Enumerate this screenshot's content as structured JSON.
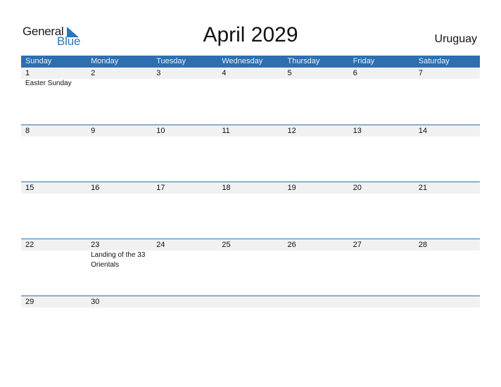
{
  "logo": {
    "word1": "General",
    "word2": "Blue",
    "icon": "triangle-flag-icon"
  },
  "title": "April 2029",
  "country": "Uruguay",
  "colors": {
    "header_bg": "#2e6fb0",
    "logo_blue": "#2a75bb",
    "row_strip": "#f1f1f1"
  },
  "weekdays": [
    "Sunday",
    "Monday",
    "Tuesday",
    "Wednesday",
    "Thursday",
    "Friday",
    "Saturday"
  ],
  "weeks": [
    {
      "days": [
        "1",
        "2",
        "3",
        "4",
        "5",
        "6",
        "7"
      ],
      "events": [
        "Easter Sunday",
        "",
        "",
        "",
        "",
        "",
        ""
      ]
    },
    {
      "days": [
        "8",
        "9",
        "10",
        "11",
        "12",
        "13",
        "14"
      ],
      "events": [
        "",
        "",
        "",
        "",
        "",
        "",
        ""
      ]
    },
    {
      "days": [
        "15",
        "16",
        "17",
        "18",
        "19",
        "20",
        "21"
      ],
      "events": [
        "",
        "",
        "",
        "",
        "",
        "",
        ""
      ]
    },
    {
      "days": [
        "22",
        "23",
        "24",
        "25",
        "26",
        "27",
        "28"
      ],
      "events": [
        "",
        "Landing of the 33 Orientals",
        "",
        "",
        "",
        "",
        ""
      ]
    },
    {
      "days": [
        "29",
        "30",
        "",
        "",
        "",
        "",
        ""
      ],
      "events": [
        "",
        "",
        "",
        "",
        "",
        "",
        ""
      ]
    }
  ]
}
